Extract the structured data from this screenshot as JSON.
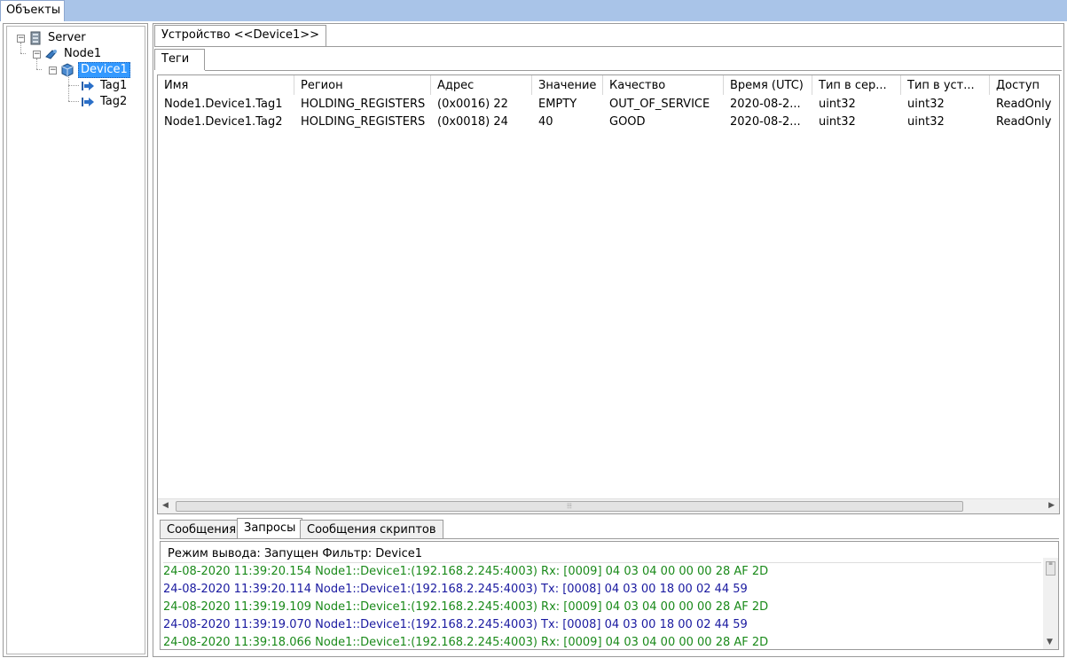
{
  "top_tab": "Объекты",
  "tree": {
    "server": "Server",
    "node": "Node1",
    "device": "Device1",
    "tags": [
      "Tag1",
      "Tag2"
    ]
  },
  "device_tab": "Устройство <<Device1>>",
  "tags_tab": "Теги",
  "columns": [
    "Имя",
    "Регион",
    "Адрес",
    "Значение",
    "Качество",
    "Время (UTC)",
    "Тип в сер...",
    "Тип в уст...",
    "Доступ"
  ],
  "rows": [
    [
      "Node1.Device1.Tag1",
      "HOLDING_REGISTERS",
      "(0x0016) 22",
      "EMPTY",
      "OUT_OF_SERVICE",
      "2020-08-2...",
      "uint32",
      "uint32",
      "ReadOnly"
    ],
    [
      "Node1.Device1.Tag2",
      "HOLDING_REGISTERS",
      "(0x0018) 24",
      "40",
      "GOOD",
      "2020-08-2...",
      "uint32",
      "uint32",
      "ReadOnly"
    ]
  ],
  "bottom_tabs": [
    "Сообщения",
    "Запросы",
    "Сообщения скриптов"
  ],
  "log": {
    "header": "Режим вывода: Запущен Фильтр: Device1",
    "lines": [
      {
        "text": "24-08-2020 11:39:20.154 Node1::Device1:(192.168.2.245:4003) Rx: [0009] 04 03 04 00 00 00 28 AF 2D",
        "dir": "rx"
      },
      {
        "text": "24-08-2020 11:39:20.114 Node1::Device1:(192.168.2.245:4003) Tx: [0008] 04 03 00 18 00 02 44 59",
        "dir": "tx"
      },
      {
        "text": "24-08-2020 11:39:19.109 Node1::Device1:(192.168.2.245:4003) Rx: [0009] 04 03 04 00 00 00 28 AF 2D",
        "dir": "rx"
      },
      {
        "text": "24-08-2020 11:39:19.070 Node1::Device1:(192.168.2.245:4003) Tx: [0008] 04 03 00 18 00 02 44 59",
        "dir": "tx"
      },
      {
        "text": "24-08-2020 11:39:18.066 Node1::Device1:(192.168.2.245:4003) Rx: [0009] 04 03 04 00 00 00 28 AF 2D",
        "dir": "rx"
      }
    ]
  },
  "colors": {
    "rx": "#1a8a1a",
    "tx": "#1a1aa0",
    "selection": "#3399ff",
    "topbar": "#a9c4e8"
  },
  "icons": {
    "server": "server-icon",
    "node": "node-icon",
    "device": "device-icon",
    "tag": "tag-arrow-icon"
  }
}
